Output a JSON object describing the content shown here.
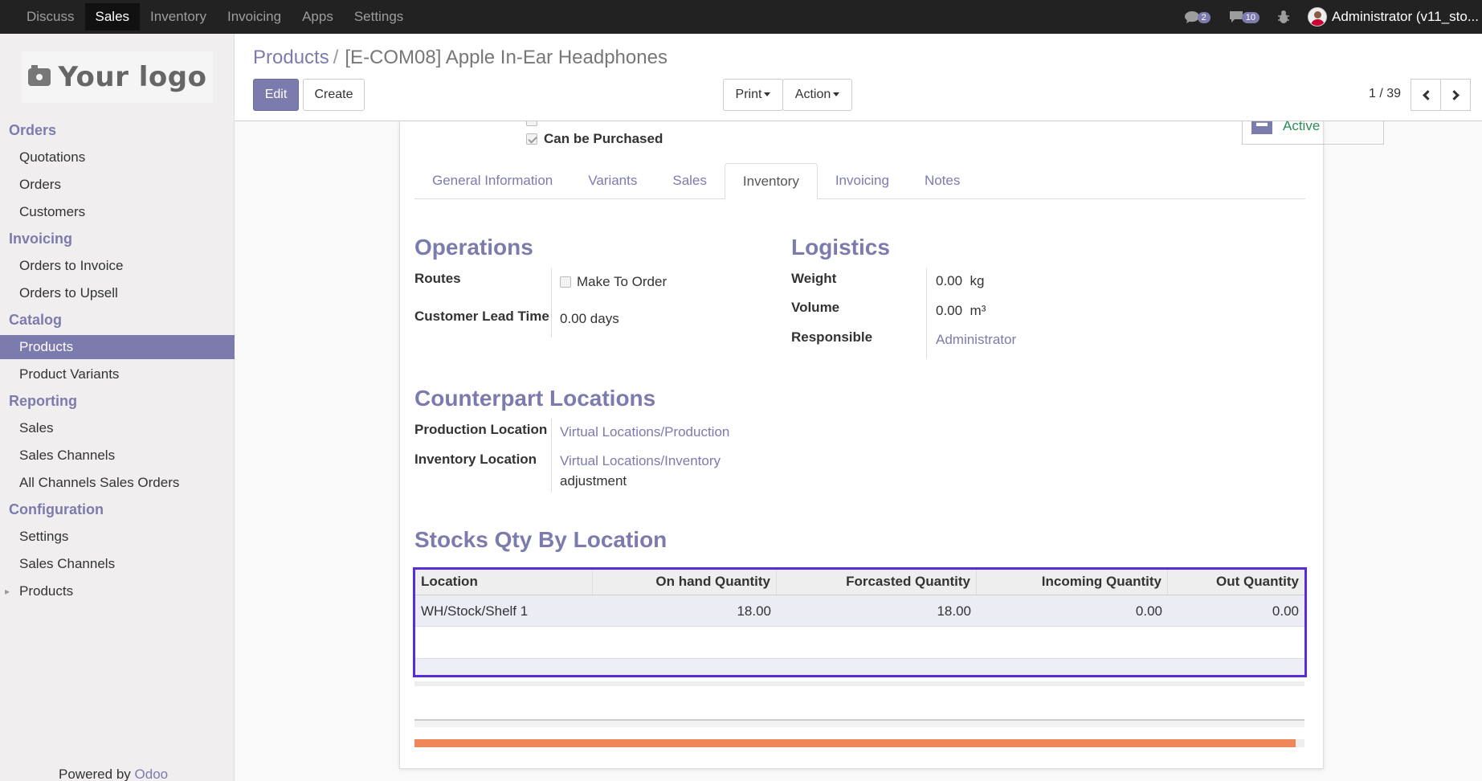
{
  "topbar": {
    "menu": [
      "Discuss",
      "Sales",
      "Inventory",
      "Invoicing",
      "Apps",
      "Settings"
    ],
    "active_menu": "Sales",
    "chat_badge": "2",
    "messages_badge": "10",
    "user": "Administrator (v11_sto..."
  },
  "sidebar": {
    "logo_text": "Your logo",
    "sections": {
      "orders": {
        "title": "Orders",
        "items": [
          "Quotations",
          "Orders",
          "Customers"
        ]
      },
      "invoicing": {
        "title": "Invoicing",
        "items": [
          "Orders to Invoice",
          "Orders to Upsell"
        ]
      },
      "catalog": {
        "title": "Catalog",
        "items": [
          "Products",
          "Product Variants"
        ]
      },
      "reporting": {
        "title": "Reporting",
        "items": [
          "Sales",
          "Sales Channels",
          "All Channels Sales Orders"
        ]
      },
      "configuration": {
        "title": "Configuration",
        "items": [
          "Settings",
          "Sales Channels",
          "Products"
        ]
      }
    },
    "powered_by": "Powered by",
    "odoo": "Odoo"
  },
  "control": {
    "breadcrumb_parent": "Products",
    "breadcrumb_sep": "/",
    "breadcrumb_current": "[E-COM08] Apple In-Ear Headphones",
    "edit": "Edit",
    "create": "Create",
    "print": "Print",
    "action": "Action",
    "pager": "1 / 39"
  },
  "form": {
    "can_be_purchased": "Can be Purchased",
    "status": "Active",
    "tabs": [
      "General Information",
      "Variants",
      "Sales",
      "Inventory",
      "Invoicing",
      "Notes"
    ],
    "active_tab": "Inventory",
    "operations": {
      "title": "Operations",
      "routes_label": "Routes",
      "make_to_order": "Make To Order",
      "lead_time_label": "Customer Lead Time",
      "lead_time_value": "0.00 days"
    },
    "logistics": {
      "title": "Logistics",
      "weight_label": "Weight",
      "weight_value": "0.00  kg",
      "volume_label": "Volume",
      "volume_value": "0.00  m³",
      "responsible_label": "Responsible",
      "responsible_value": "Administrator"
    },
    "counterpart": {
      "title": "Counterpart Locations",
      "production_label": "Production Location",
      "production_value": "Virtual Locations/Production",
      "inventory_label": "Inventory Location",
      "inventory_value": "Virtual Locations/Inventory",
      "inventory_value_cont": "adjustment"
    },
    "stocks": {
      "title": "Stocks Qty By Location",
      "columns": [
        "Location",
        "On hand Quantity",
        "Forcasted Quantity",
        "Incoming Quantity",
        "Out Quantity"
      ],
      "rows": [
        [
          "WH/Stock/Shelf 1",
          "18.00",
          "18.00",
          "0.00",
          "0.00"
        ]
      ]
    },
    "progress": 0.99
  },
  "colors": {
    "brand": "#7c7bad",
    "navbar": "#222222",
    "highlight_border": "#5a2bd8",
    "progress": "#f0875a",
    "status_active": "#2e8b57"
  }
}
